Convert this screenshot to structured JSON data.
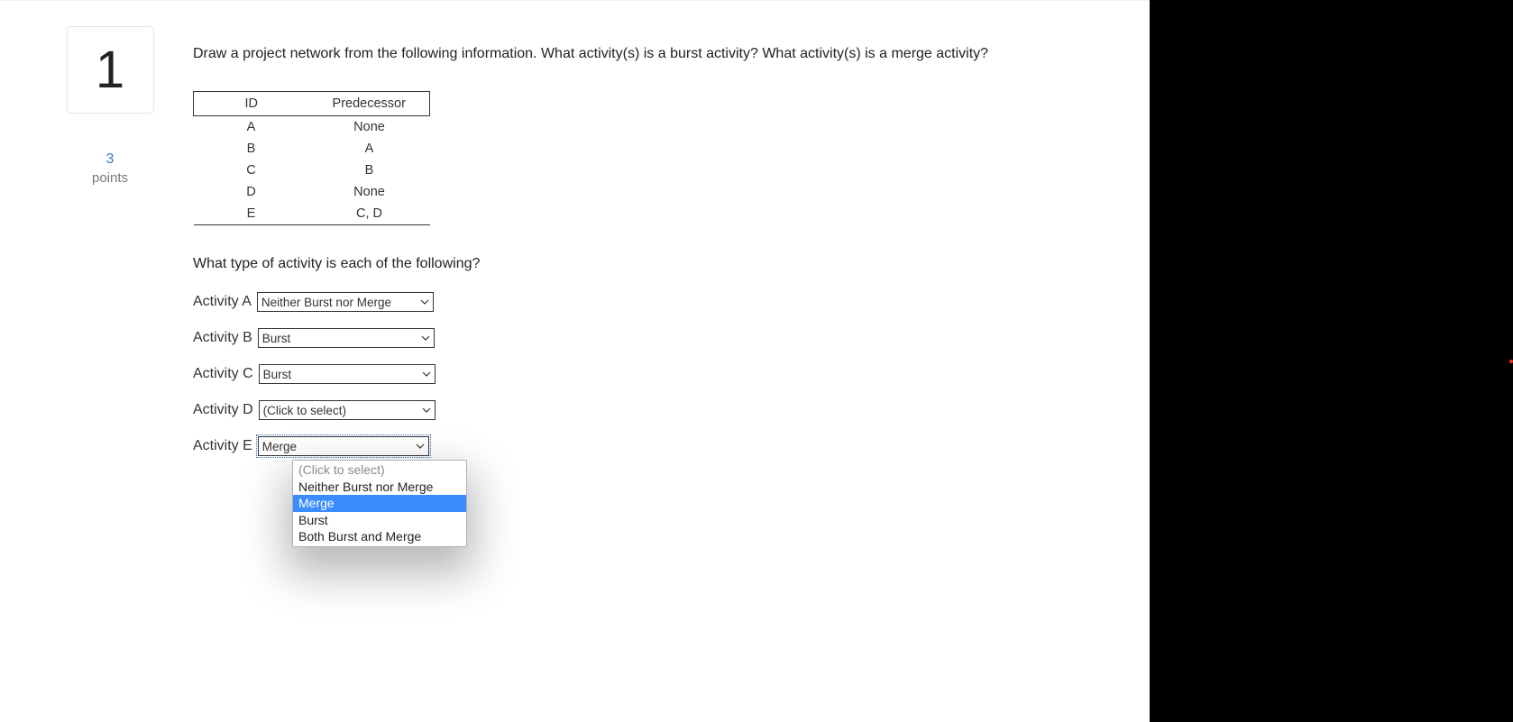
{
  "question": {
    "number": "1",
    "points_value": "3",
    "points_label": "points",
    "prompt": "Draw a project network from the following information. What activity(s) is a burst activity? What activity(s) is a merge activity?",
    "subprompt": "What type of activity is each of the following?"
  },
  "pred_table": {
    "headers": {
      "id": "ID",
      "pred": "Predecessor"
    },
    "rows": [
      {
        "id": "A",
        "pred": "None"
      },
      {
        "id": "B",
        "pred": "A"
      },
      {
        "id": "C",
        "pred": "B"
      },
      {
        "id": "D",
        "pred": "None"
      },
      {
        "id": "E",
        "pred": "C, D"
      }
    ]
  },
  "answers": [
    {
      "label": "Activity A",
      "value": "Neither Burst nor Merge"
    },
    {
      "label": "Activity B",
      "value": "Burst"
    },
    {
      "label": "Activity C",
      "value": "Burst"
    },
    {
      "label": "Activity D",
      "value": "(Click to select)"
    },
    {
      "label": "Activity E",
      "value": "Merge"
    }
  ],
  "dropdown": {
    "options": [
      {
        "text": "(Click to select)",
        "placeholder": true,
        "highlight": false
      },
      {
        "text": "Neither Burst nor Merge",
        "placeholder": false,
        "highlight": false
      },
      {
        "text": "Merge",
        "placeholder": false,
        "highlight": true
      },
      {
        "text": "Burst",
        "placeholder": false,
        "highlight": false
      },
      {
        "text": "Both Burst and Merge",
        "placeholder": false,
        "highlight": false
      }
    ]
  }
}
